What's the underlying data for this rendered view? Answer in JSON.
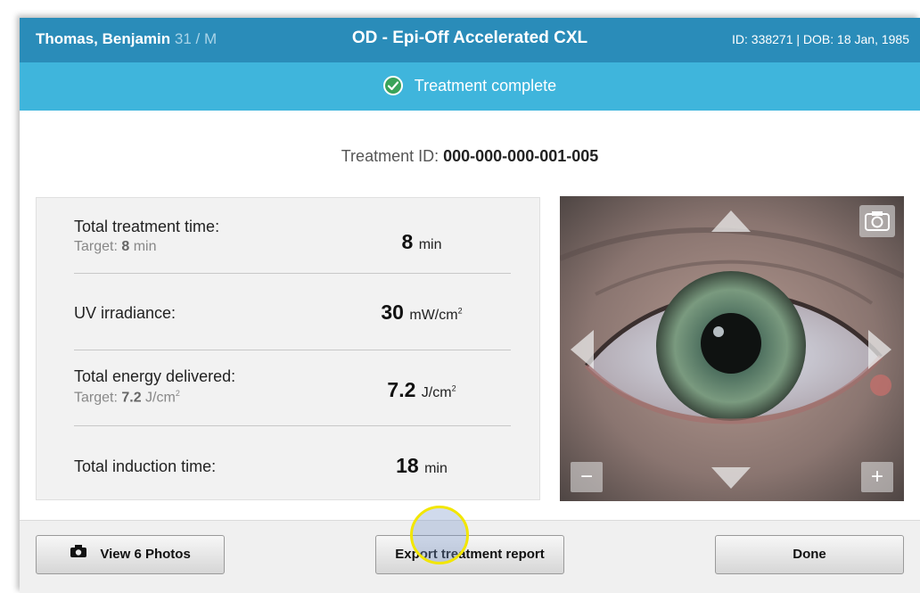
{
  "header": {
    "patient_name": "Thomas, Benjamin",
    "patient_age_sex": "31 / M",
    "procedure": "OD - Epi-Off Accelerated CXL",
    "id_dob": "ID: 338271 | DOB: 18 Jan, 1985"
  },
  "status": {
    "text": "Treatment complete",
    "icon": "check-circle-icon",
    "color": "#3fb5dc"
  },
  "treatment": {
    "label": "Treatment ID:",
    "value": "000-000-000-001-005"
  },
  "metrics": [
    {
      "label": "Total treatment time:",
      "target_label": "Target: ",
      "target_value": "8",
      "target_unit": " min",
      "value": "8",
      "unit": "min"
    },
    {
      "label": "UV irradiance:",
      "value": "30",
      "unit": "mW/cm",
      "unit_sup": "2"
    },
    {
      "label": "Total energy delivered:",
      "target_label": "Target: ",
      "target_value": "7.2",
      "target_unit": " J/cm",
      "target_sup": "2",
      "value": "7.2",
      "unit": "J/cm",
      "unit_sup": "2"
    },
    {
      "label": "Total induction time:",
      "value": "18",
      "unit": "min"
    }
  ],
  "camera": {
    "zoom_out": "−",
    "zoom_in": "+"
  },
  "footer": {
    "photos_label": "View 6 Photos",
    "export_label": "Export treatment report",
    "done_label": "Done"
  },
  "colors": {
    "header_bg": "#2a8cb9",
    "status_bg": "#3fb5dc",
    "check_green": "#3aa35a"
  }
}
